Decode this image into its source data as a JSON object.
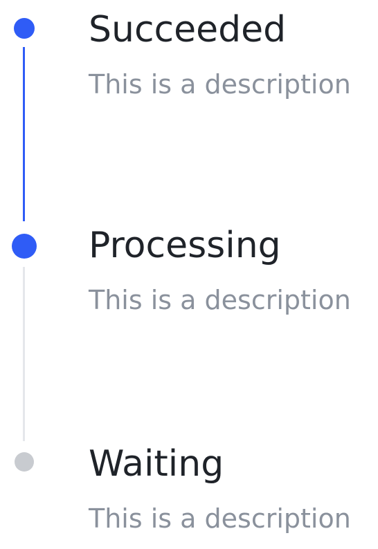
{
  "colors": {
    "accent": "#2f5cf6",
    "muted": "#c8cbd0",
    "pending_line": "#e5e7eb",
    "title": "#1f2329",
    "description": "#8a919c"
  },
  "steps": [
    {
      "title": "Succeeded",
      "description": "This is a description",
      "status": "finished"
    },
    {
      "title": "Processing",
      "description": "This is a description",
      "status": "process"
    },
    {
      "title": "Waiting",
      "description": "This is a description",
      "status": "wait"
    }
  ]
}
